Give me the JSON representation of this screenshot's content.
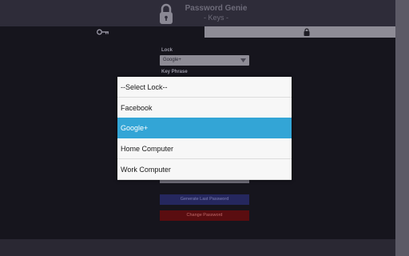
{
  "header": {
    "title": "Password Genie",
    "subtitle": "- Keys -"
  },
  "tabs": [
    {
      "icon": "key-icon"
    },
    {
      "icon": "lock-icon"
    }
  ],
  "form": {
    "lock_label": "Lock",
    "lock_value": "Google+",
    "keyphrase_label": "Key Phrase"
  },
  "buttons": {
    "generate_last": "Generate Last Password",
    "change_password": "Change Password"
  },
  "dialog": {
    "options": [
      "--Select Lock--",
      "Facebook",
      "Google+",
      "Home Computer",
      "Work Computer"
    ],
    "selected": "Google+"
  },
  "colors": {
    "accent": "#33a5d6",
    "background": "#16151d",
    "generate_button": "#25275e",
    "change_button": "#5a0d10"
  }
}
